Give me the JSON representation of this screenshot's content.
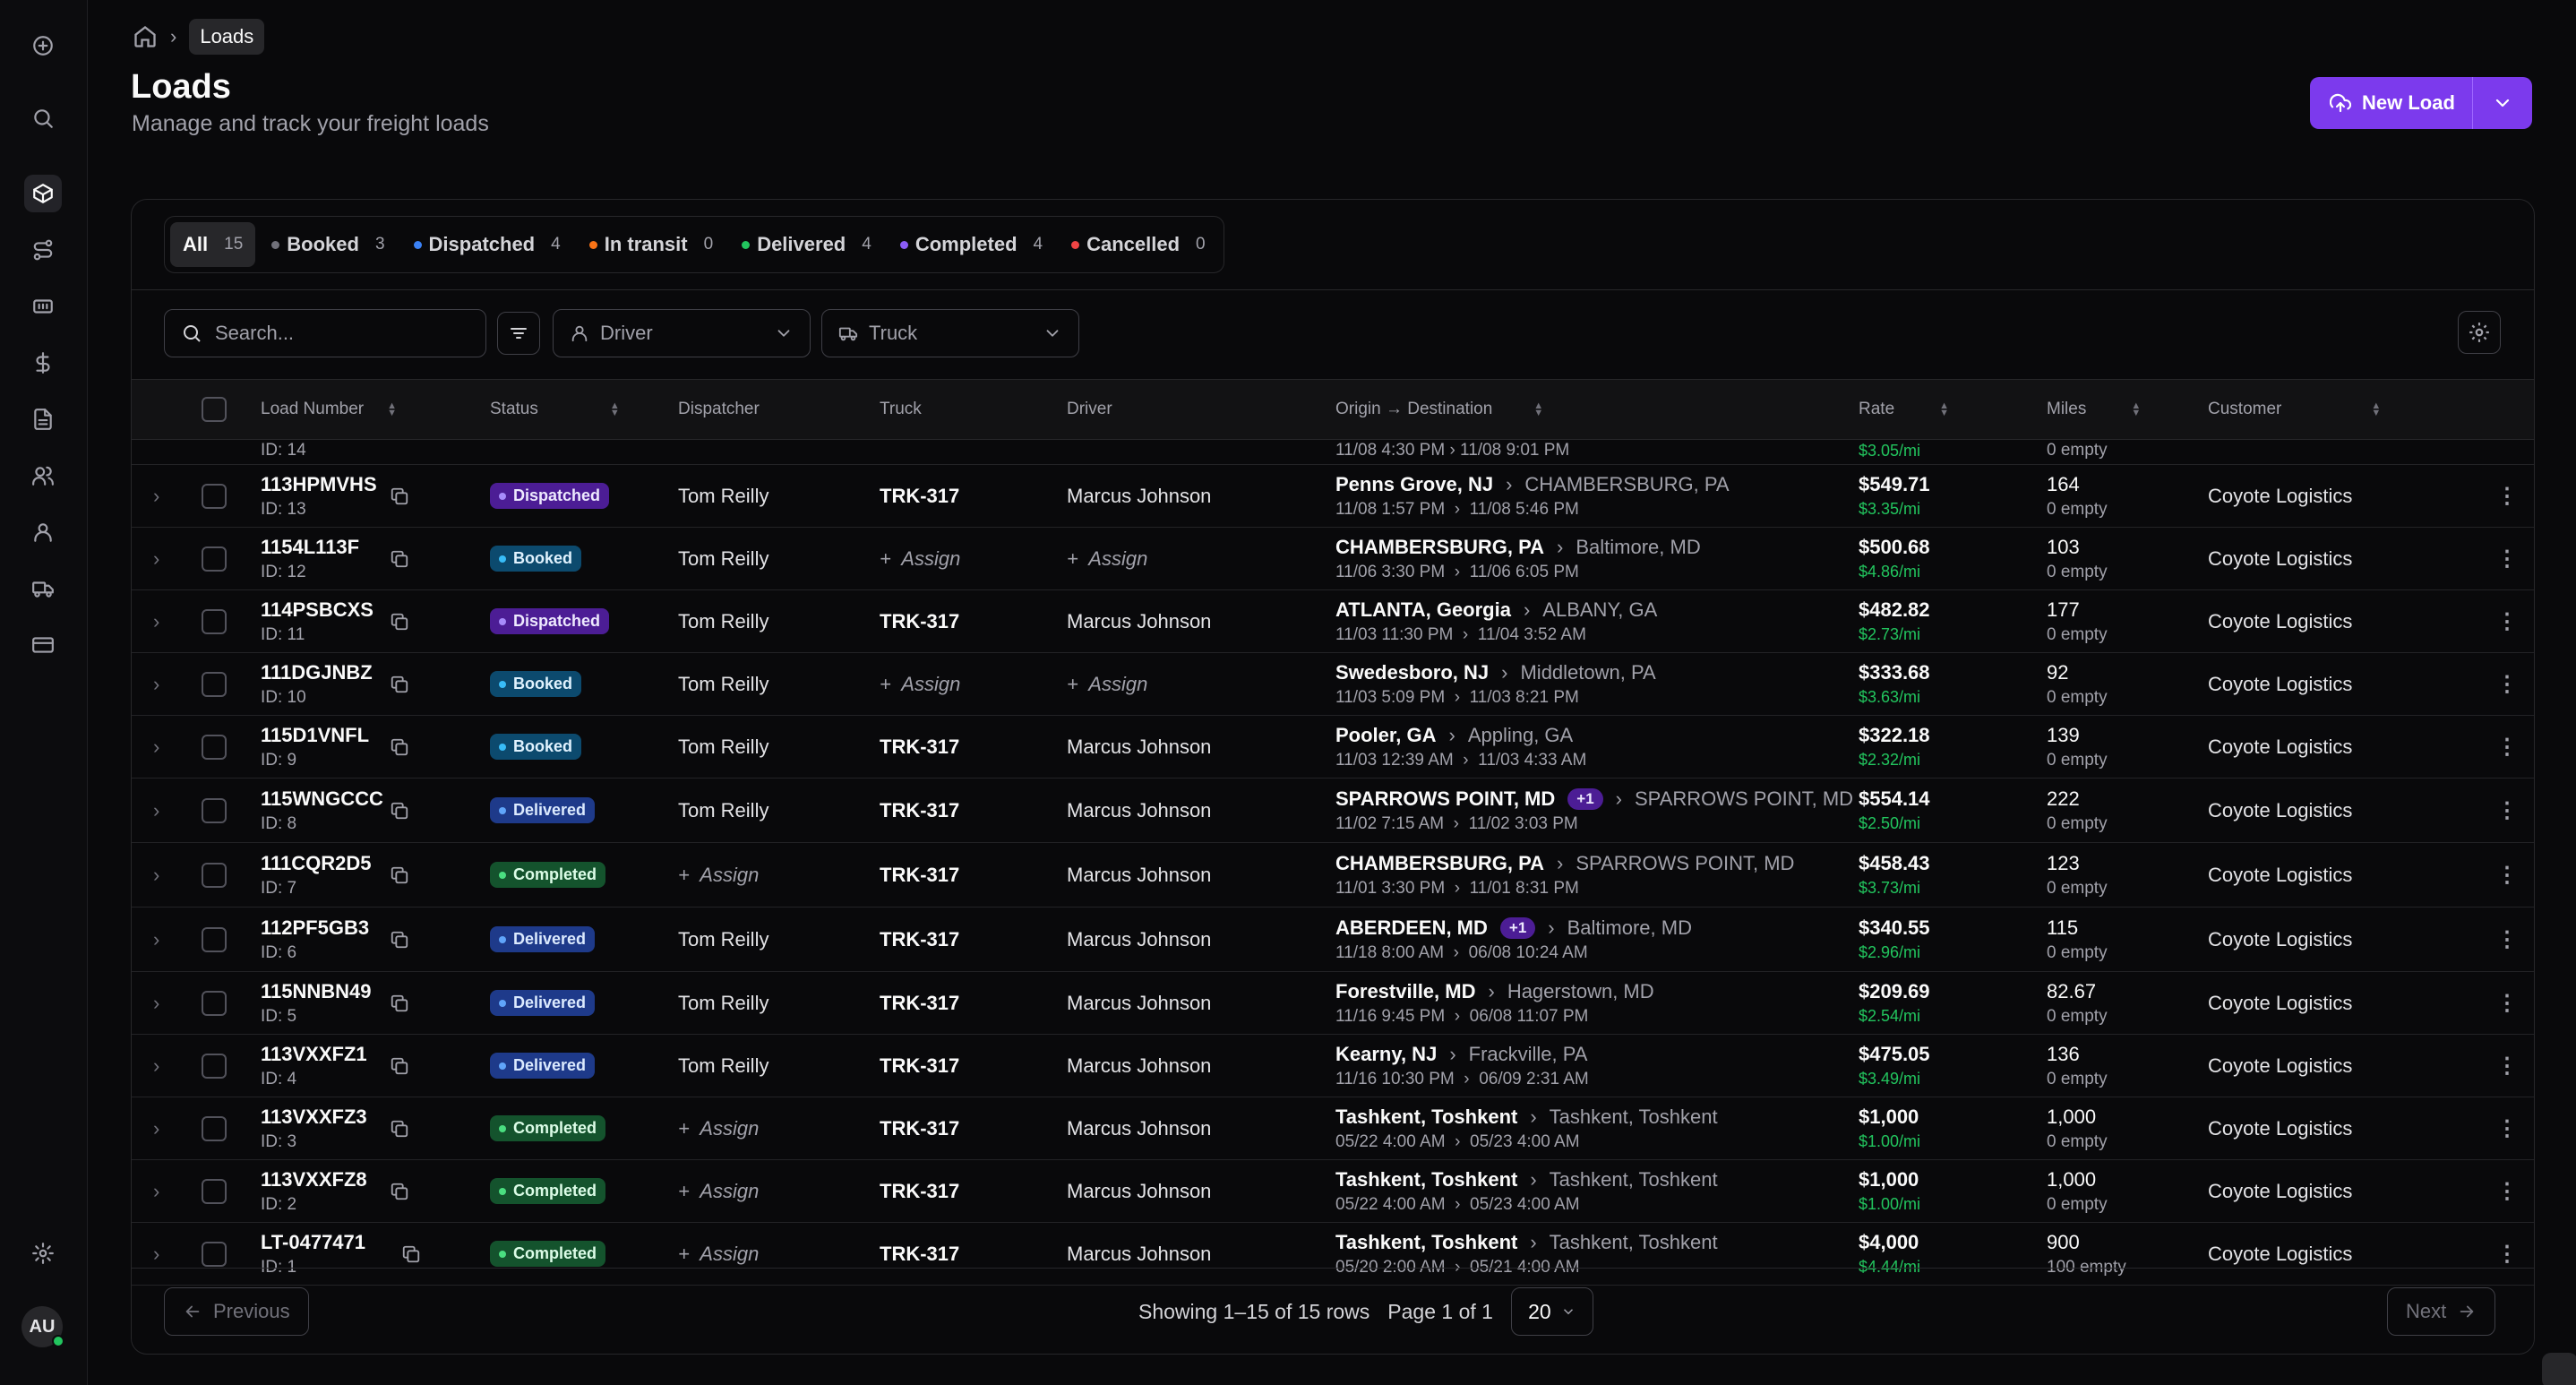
{
  "breadcrumb": {
    "current": "Loads"
  },
  "header": {
    "title": "Loads",
    "subtitle": "Manage and track your freight loads",
    "new_load_label": "New Load"
  },
  "tabs": [
    {
      "label": "All",
      "count": "15",
      "color": ""
    },
    {
      "label": "Booked",
      "count": "3",
      "color": "#71717a"
    },
    {
      "label": "Dispatched",
      "count": "4",
      "color": "#3b82f6"
    },
    {
      "label": "In transit",
      "count": "0",
      "color": "#f97316"
    },
    {
      "label": "Delivered",
      "count": "4",
      "color": "#22c55e"
    },
    {
      "label": "Completed",
      "count": "4",
      "color": "#8b5cf6"
    },
    {
      "label": "Cancelled",
      "count": "0",
      "color": "#ef4444"
    }
  ],
  "filters": {
    "search_placeholder": "Search...",
    "driver_label": "Driver",
    "truck_label": "Truck"
  },
  "columns": {
    "load_number": "Load Number",
    "status": "Status",
    "dispatcher": "Dispatcher",
    "truck": "Truck",
    "driver": "Driver",
    "route": "Origin → Destination",
    "rate": "Rate",
    "miles": "Miles",
    "customer": "Customer"
  },
  "partial_row": {
    "id": "ID: 14",
    "times": "11/08 4:30 PM  ›  11/08 9:01 PM",
    "per_mile": "$3.05/mi",
    "empty": "0 empty"
  },
  "rows": [
    {
      "load": "113HPMVHS",
      "id": "ID: 13",
      "status": "Dispatched",
      "status_class": "b-dispatched",
      "dispatcher": "Tom Reilly",
      "truck": "TRK-317",
      "driver": "Marcus Johnson",
      "origin": "Penns Grove, NJ",
      "origin_extra": "",
      "dest": "CHAMBERSBURG, PA",
      "pickup": "11/08 1:57 PM",
      "delivery": "11/08 5:46 PM",
      "rate": "$549.71",
      "per_mile": "$3.35/mi",
      "miles": "164",
      "empty": "0 empty",
      "customer": "Coyote Logistics"
    },
    {
      "load": "1154L113F",
      "id": "ID: 12",
      "status": "Booked",
      "status_class": "b-booked",
      "dispatcher": "Tom Reilly",
      "truck": "",
      "driver": "",
      "origin": "CHAMBERSBURG, PA",
      "origin_extra": "",
      "dest": "Baltimore, MD",
      "pickup": "11/06 3:30 PM",
      "delivery": "11/06 6:05 PM",
      "rate": "$500.68",
      "per_mile": "$4.86/mi",
      "miles": "103",
      "empty": "0 empty",
      "customer": "Coyote Logistics"
    },
    {
      "load": "114PSBCXS",
      "id": "ID: 11",
      "status": "Dispatched",
      "status_class": "b-dispatched",
      "dispatcher": "Tom Reilly",
      "truck": "TRK-317",
      "driver": "Marcus Johnson",
      "origin": "ATLANTA, Georgia",
      "origin_extra": "",
      "dest": "ALBANY, GA",
      "pickup": "11/03 11:30 PM",
      "delivery": "11/04 3:52 AM",
      "rate": "$482.82",
      "per_mile": "$2.73/mi",
      "miles": "177",
      "empty": "0 empty",
      "customer": "Coyote Logistics"
    },
    {
      "load": "111DGJNBZ",
      "id": "ID: 10",
      "status": "Booked",
      "status_class": "b-booked",
      "dispatcher": "Tom Reilly",
      "truck": "",
      "driver": "",
      "origin": "Swedesboro, NJ",
      "origin_extra": "",
      "dest": "Middletown, PA",
      "pickup": "11/03 5:09 PM",
      "delivery": "11/03 8:21 PM",
      "rate": "$333.68",
      "per_mile": "$3.63/mi",
      "miles": "92",
      "empty": "0 empty",
      "customer": "Coyote Logistics"
    },
    {
      "load": "115D1VNFL",
      "id": "ID: 9",
      "status": "Booked",
      "status_class": "b-booked",
      "dispatcher": "Tom Reilly",
      "truck": "TRK-317",
      "driver": "Marcus Johnson",
      "origin": "Pooler, GA",
      "origin_extra": "",
      "dest": "Appling, GA",
      "pickup": "11/03 12:39 AM",
      "delivery": "11/03 4:33 AM",
      "rate": "$322.18",
      "per_mile": "$2.32/mi",
      "miles": "139",
      "empty": "0 empty",
      "customer": "Coyote Logistics"
    },
    {
      "load": "115WNGCCC",
      "id": "ID: 8",
      "status": "Delivered",
      "status_class": "b-delivered",
      "dispatcher": "Tom Reilly",
      "truck": "TRK-317",
      "driver": "Marcus Johnson",
      "origin": "SPARROWS POINT, MD",
      "origin_extra": "+1",
      "dest": "SPARROWS POINT, MD",
      "pickup": "11/02 7:15 AM",
      "delivery": "11/02 3:03 PM",
      "rate": "$554.14",
      "per_mile": "$2.50/mi",
      "miles": "222",
      "empty": "0 empty",
      "customer": "Coyote Logistics"
    },
    {
      "load": "111CQR2D5",
      "id": "ID: 7",
      "status": "Completed",
      "status_class": "b-completed",
      "dispatcher": "",
      "truck": "TRK-317",
      "driver": "Marcus Johnson",
      "origin": "CHAMBERSBURG, PA",
      "origin_extra": "",
      "dest": "SPARROWS POINT, MD",
      "pickup": "11/01 3:30 PM",
      "delivery": "11/01 8:31 PM",
      "rate": "$458.43",
      "per_mile": "$3.73/mi",
      "miles": "123",
      "empty": "0 empty",
      "customer": "Coyote Logistics"
    },
    {
      "load": "112PF5GB3",
      "id": "ID: 6",
      "status": "Delivered",
      "status_class": "b-delivered",
      "dispatcher": "Tom Reilly",
      "truck": "TRK-317",
      "driver": "Marcus Johnson",
      "origin": "ABERDEEN, MD",
      "origin_extra": "+1",
      "dest": "Baltimore, MD",
      "pickup": "11/18 8:00 AM",
      "delivery": "06/08 10:24 AM",
      "rate": "$340.55",
      "per_mile": "$2.96/mi",
      "miles": "115",
      "empty": "0 empty",
      "customer": "Coyote Logistics"
    },
    {
      "load": "115NNBN49",
      "id": "ID: 5",
      "status": "Delivered",
      "status_class": "b-delivered",
      "dispatcher": "Tom Reilly",
      "truck": "TRK-317",
      "driver": "Marcus Johnson",
      "origin": "Forestville, MD",
      "origin_extra": "",
      "dest": "Hagerstown, MD",
      "pickup": "11/16 9:45 PM",
      "delivery": "06/08 11:07 PM",
      "rate": "$209.69",
      "per_mile": "$2.54/mi",
      "miles": "82.67",
      "empty": "0 empty",
      "customer": "Coyote Logistics"
    },
    {
      "load": "113VXXFZ1",
      "id": "ID: 4",
      "status": "Delivered",
      "status_class": "b-delivered",
      "dispatcher": "Tom Reilly",
      "truck": "TRK-317",
      "driver": "Marcus Johnson",
      "origin": "Kearny, NJ",
      "origin_extra": "",
      "dest": "Frackville, PA",
      "pickup": "11/16 10:30 PM",
      "delivery": "06/09 2:31 AM",
      "rate": "$475.05",
      "per_mile": "$3.49/mi",
      "miles": "136",
      "empty": "0 empty",
      "customer": "Coyote Logistics"
    },
    {
      "load": "113VXXFZ3",
      "id": "ID: 3",
      "status": "Completed",
      "status_class": "b-completed",
      "dispatcher": "",
      "truck": "TRK-317",
      "driver": "Marcus Johnson",
      "origin": "Tashkent, Toshkent",
      "origin_extra": "",
      "dest": "Tashkent, Toshkent",
      "pickup": "05/22 4:00 AM",
      "delivery": "05/23 4:00 AM",
      "rate": "$1,000",
      "per_mile": "$1.00/mi",
      "miles": "1,000",
      "empty": "0 empty",
      "customer": "Coyote Logistics"
    },
    {
      "load": "113VXXFZ8",
      "id": "ID: 2",
      "status": "Completed",
      "status_class": "b-completed",
      "dispatcher": "",
      "truck": "TRK-317",
      "driver": "Marcus Johnson",
      "origin": "Tashkent, Toshkent",
      "origin_extra": "",
      "dest": "Tashkent, Toshkent",
      "pickup": "05/22 4:00 AM",
      "delivery": "05/23 4:00 AM",
      "rate": "$1,000",
      "per_mile": "$1.00/mi",
      "miles": "1,000",
      "empty": "0 empty",
      "customer": "Coyote Logistics"
    },
    {
      "load": "LT-0477471",
      "id": "ID: 1",
      "status": "Completed",
      "status_class": "b-completed",
      "dispatcher": "",
      "truck": "TRK-317",
      "driver": "Marcus Johnson",
      "origin": "Tashkent, Toshkent",
      "origin_extra": "",
      "dest": "Tashkent, Toshkent",
      "pickup": "05/20 2:00 AM",
      "delivery": "05/21 4:00 AM",
      "rate": "$4,000",
      "per_mile": "$4.44/mi",
      "miles": "900",
      "empty": "100 empty",
      "customer": "Coyote Logistics"
    }
  ],
  "assign_label": "Assign",
  "pagination": {
    "previous": "Previous",
    "next": "Next",
    "showing": "Showing 1–15 of 15 rows",
    "page": "Page 1 of 1",
    "page_size": "20"
  },
  "user": {
    "initials": "AU"
  }
}
